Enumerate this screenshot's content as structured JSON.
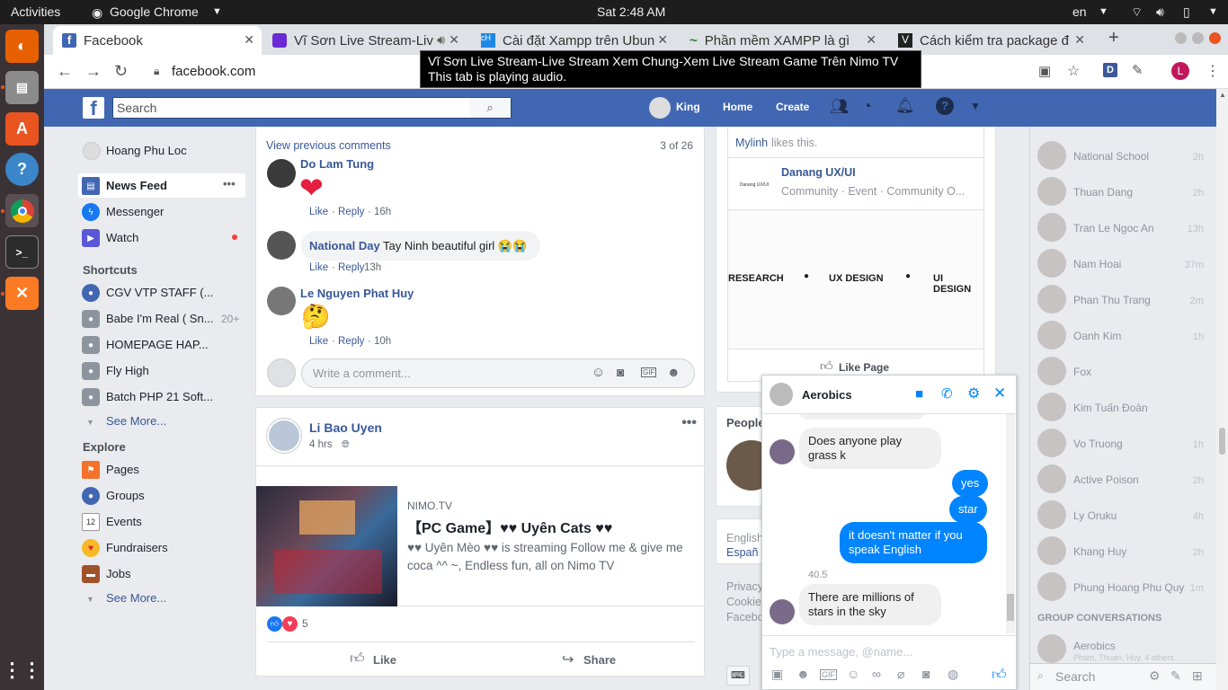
{
  "os": {
    "activities": "Activities",
    "app_name": "Google Chrome",
    "clock": "Sat  2:48 AM",
    "lang": "en"
  },
  "tabs": [
    {
      "label": "Facebook"
    },
    {
      "label": "Vĩ Sơn Live Stream-Liv"
    },
    {
      "label": "Cài đặt Xampp trên Ubun"
    },
    {
      "label": "Phần mềm XAMPP là gì"
    },
    {
      "label": "Cách kiểm tra package đ"
    }
  ],
  "tooltip": {
    "line1": "Vĩ Sơn Live Stream-Live Stream Xem Chung-Xem Live Stream Game Trên Nimo TV",
    "line2": "This tab is playing audio."
  },
  "url": "facebook.com",
  "profile_initial": "L",
  "ext_initial": "D",
  "fb": {
    "search_placeholder": "Search",
    "user": "King",
    "home": "Home",
    "create": "Create"
  },
  "left": {
    "profile": "Hoang Phu Loc",
    "news_feed": "News Feed",
    "messenger": "Messenger",
    "watch": "Watch",
    "shortcuts_header": "Shortcuts",
    "shortcuts": [
      {
        "label": "CGV VTP STAFF (..."
      },
      {
        "label": "Babe I'm Real ( Sn...",
        "count": "20+"
      },
      {
        "label": "HOMEPAGE HAP..."
      },
      {
        "label": "Fly High"
      },
      {
        "label": "Batch PHP 21 Soft..."
      }
    ],
    "see_more": "See More...",
    "explore_header": "Explore",
    "explore": [
      {
        "label": "Pages"
      },
      {
        "label": "Groups"
      },
      {
        "label": "Events"
      },
      {
        "label": "Fundraisers"
      },
      {
        "label": "Jobs"
      }
    ],
    "events_day": "12",
    "see_more2": "See More..."
  },
  "post1": {
    "view_prev": "View previous comments",
    "count": "3 of 26",
    "comments": [
      {
        "name": "Do Lam Tung",
        "text": "",
        "emoji": "❤",
        "like": "Like",
        "reply": "Reply",
        "time": "16h"
      },
      {
        "name": "National Day",
        "text": "Tay Ninh beautiful girl 😭😭",
        "like": "Like",
        "reply": "Reply",
        "time": "13h"
      },
      {
        "name": "Le Nguyen Phat Huy",
        "text": "",
        "emoji": "🤔",
        "like": "Like",
        "reply": "Reply",
        "time": "10h"
      }
    ],
    "comment_placeholder": "Write a comment..."
  },
  "post2": {
    "name": "Li Bao Uyen",
    "time": "4 hrs",
    "source": "NIMO.TV",
    "title": "【PC Game】♥♥ Uyên Cats ♥♥",
    "desc": "♥♥ Uyên Mèo ♥♥ is streaming Follow me & give me coca ^^ ~, Endless fun, all on Nimo TV",
    "reactions": "5",
    "like": "Like",
    "share": "Share"
  },
  "rightcol": {
    "likes_name": "Mylinh",
    "likes_text": "likes this.",
    "page_name": "Danang UX/UI",
    "page_logo": "Danang UX/UI",
    "page_type": "Community · Event · Community O...",
    "banner": [
      "RESEARCH",
      "UX DESIGN",
      "UI DESIGN"
    ],
    "like_page": "Like Page",
    "people": "People",
    "lang1": "English",
    "lang2": "Españ",
    "footer1": "Privacy",
    "footer2": "Cookie",
    "footer3": "Facebo"
  },
  "chat": {
    "title": "Aerobics",
    "messages": [
      {
        "dir": "in",
        "text": "Does anyone play grass k"
      },
      {
        "dir": "out",
        "text": "yes"
      },
      {
        "dir": "out",
        "text": "star"
      },
      {
        "dir": "out",
        "text": "it doesn't matter if you speak English"
      },
      {
        "dir": "in",
        "text": "There are millions of stars in the sky"
      }
    ],
    "sender_label": "40.5",
    "input_placeholder": "Type a message, @name..."
  },
  "contacts": [
    {
      "name": "National School",
      "time": "2h"
    },
    {
      "name": "Thuan Dang",
      "time": "2h"
    },
    {
      "name": "Tran Le Ngoc An",
      "time": "13h"
    },
    {
      "name": "Nam Hoai",
      "time": "37m"
    },
    {
      "name": "Phan Thu Trang",
      "time": "2m"
    },
    {
      "name": "Oanh Kim",
      "time": "1h"
    },
    {
      "name": "Fox",
      "time": ""
    },
    {
      "name": "Kim Tuấn Đoàn",
      "time": ""
    },
    {
      "name": "Vo Truong",
      "time": "1h"
    },
    {
      "name": "Active Poison",
      "time": "2h"
    },
    {
      "name": "Ly Oruku",
      "time": "4h"
    },
    {
      "name": "Khang Huy",
      "time": "2h"
    },
    {
      "name": "Phung Hoang Phu Quy",
      "time": "1m"
    }
  ],
  "group_header": "GROUP CONVERSATIONS",
  "group": {
    "name": "Aerobics",
    "members": "Pham, Thuan, Huy, 4 others"
  },
  "sidebar_search": "Search"
}
